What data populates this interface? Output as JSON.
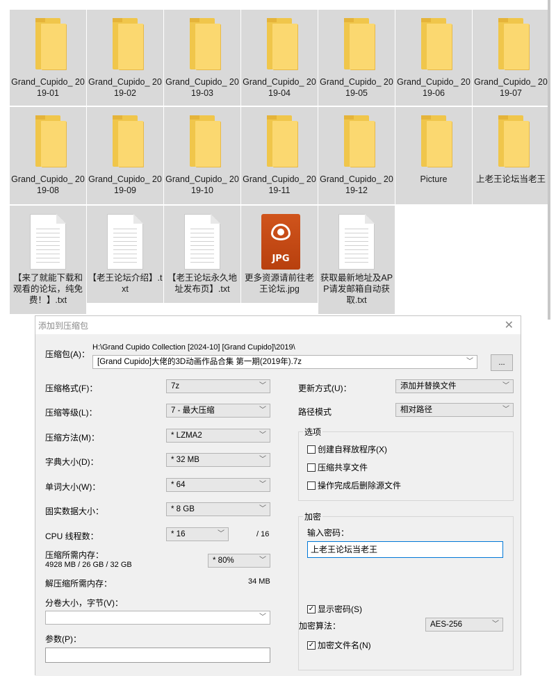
{
  "explorer": {
    "row1": [
      "Grand_Cupido_ 2019-01",
      "Grand_Cupido_ 2019-02",
      "Grand_Cupido_ 2019-03",
      "Grand_Cupido_ 2019-04",
      "Grand_Cupido_ 2019-05",
      "Grand_Cupido_ 2019-06",
      "Grand_Cupido_ 2019-07"
    ],
    "row2": [
      "Grand_Cupido_ 2019-08",
      "Grand_Cupido_ 2019-09",
      "Grand_Cupido_ 2019-10",
      "Grand_Cupido_ 2019-11",
      "Grand_Cupido_ 2019-12",
      "Picture",
      "上老王论坛当老王"
    ],
    "row3": [
      "【来了就能下载和观看的论坛，纯免费！】.txt",
      "【老王论坛介绍】.txt",
      "【老王论坛永久地址发布页】.txt",
      "更多资源请前往老王论坛.jpg",
      "获取最新地址及APP请发邮箱自动获取.txt"
    ],
    "jpg_badge": "JPG"
  },
  "dialog": {
    "title": "添加到压缩包",
    "close": "✕",
    "archive_label": "压缩包(A)：",
    "archive_path": "H:\\Grand Cupido Collection [2024-10] [Grand Cupido]\\2019\\",
    "archive_name": "[Grand Cupido]大佬的3D动画作品合集 第一期(2019年).7z",
    "browse_button": "...",
    "format_label": "压缩格式(F)：",
    "format_value": "7z",
    "level_label": "压缩等级(L)：",
    "level_value": "7 - 最大压缩",
    "method_label": "压缩方法(M)：",
    "method_value": "* LZMA2",
    "dict_label": "字典大小(D)：",
    "dict_value": "* 32 MB",
    "word_label": "单词大小(W)：",
    "word_value": "* 64",
    "solid_label": "固实数据大小：",
    "solid_value": "* 8 GB",
    "cpu_label": "CPU 线程数：",
    "cpu_value": "* 16",
    "cpu_total": "/ 16",
    "mem_label": "压缩所需内存：",
    "mem_detail": "4928 MB / 26 GB / 32 GB",
    "mem_value": "* 80%",
    "decomp_label": "解压缩所需内存：",
    "decomp_value": "34 MB",
    "volume_label": "分卷大小，字节(V)：",
    "volume_value": "",
    "params_label": "参数(P)：",
    "params_value": "",
    "update_label": "更新方式(U)：",
    "update_value": "添加并替换文件",
    "path_label": "路径模式",
    "path_value": "相对路径",
    "options_title": "选项",
    "opt_sfx": "创建自释放程序(X)",
    "opt_shared": "压缩共享文件",
    "opt_delete": "操作完成后删除源文件",
    "encrypt_title": "加密",
    "pwd_label": "输入密码：",
    "pwd_value": "上老王论坛当老王",
    "show_pwd": "显示密码(S)",
    "enc_method_label": "加密算法：",
    "enc_method_value": "AES-256",
    "enc_names": "加密文件名(N)"
  }
}
